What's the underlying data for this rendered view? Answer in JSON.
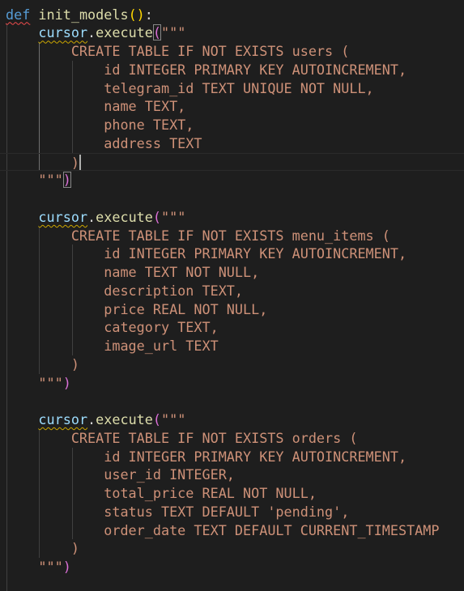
{
  "editor": {
    "language": "python",
    "lines": [
      {
        "indent": "",
        "tokens": [
          {
            "t": "def",
            "c": "kw squig"
          },
          {
            "t": " ",
            "c": "punc"
          },
          {
            "t": "init_models",
            "c": "fn"
          },
          {
            "t": "(",
            "c": "brk"
          },
          {
            "t": ")",
            "c": "brk"
          },
          {
            "t": ":",
            "c": "punc"
          }
        ]
      },
      {
        "indent": "    ",
        "tokens": [
          {
            "t": "cursor",
            "c": "var warn"
          },
          {
            "t": ".",
            "c": "punc"
          },
          {
            "t": "execute",
            "c": "fn"
          },
          {
            "t": "(",
            "c": "brk2 matchbox"
          },
          {
            "t": "\"\"\"",
            "c": "str"
          }
        ]
      },
      {
        "indent": "        ",
        "tokens": [
          {
            "t": "CREATE TABLE IF NOT EXISTS users (",
            "c": "str"
          }
        ]
      },
      {
        "indent": "            ",
        "tokens": [
          {
            "t": "id INTEGER PRIMARY KEY AUTOINCREMENT,",
            "c": "str"
          }
        ]
      },
      {
        "indent": "            ",
        "tokens": [
          {
            "t": "telegram_id TEXT UNIQUE NOT NULL,",
            "c": "str"
          }
        ]
      },
      {
        "indent": "            ",
        "tokens": [
          {
            "t": "name TEXT,",
            "c": "str"
          }
        ]
      },
      {
        "indent": "            ",
        "tokens": [
          {
            "t": "phone TEXT,",
            "c": "str"
          }
        ]
      },
      {
        "indent": "            ",
        "tokens": [
          {
            "t": "address TEXT",
            "c": "str"
          }
        ]
      },
      {
        "indent": "        ",
        "tokens": [
          {
            "t": ")",
            "c": "str"
          }
        ],
        "caret": true,
        "current": true
      },
      {
        "indent": "    ",
        "tokens": [
          {
            "t": "\"\"\"",
            "c": "str"
          },
          {
            "t": ")",
            "c": "brk2 matchbox"
          }
        ]
      },
      {
        "indent": "",
        "tokens": []
      },
      {
        "indent": "    ",
        "tokens": [
          {
            "t": "cursor",
            "c": "var warn"
          },
          {
            "t": ".",
            "c": "punc"
          },
          {
            "t": "execute",
            "c": "fn"
          },
          {
            "t": "(",
            "c": "brk2"
          },
          {
            "t": "\"\"\"",
            "c": "str"
          }
        ]
      },
      {
        "indent": "        ",
        "tokens": [
          {
            "t": "CREATE TABLE IF NOT EXISTS menu_items (",
            "c": "str"
          }
        ]
      },
      {
        "indent": "            ",
        "tokens": [
          {
            "t": "id INTEGER PRIMARY KEY AUTOINCREMENT,",
            "c": "str"
          }
        ]
      },
      {
        "indent": "            ",
        "tokens": [
          {
            "t": "name TEXT NOT NULL,",
            "c": "str"
          }
        ]
      },
      {
        "indent": "            ",
        "tokens": [
          {
            "t": "description TEXT,",
            "c": "str"
          }
        ]
      },
      {
        "indent": "            ",
        "tokens": [
          {
            "t": "price REAL NOT NULL,",
            "c": "str"
          }
        ]
      },
      {
        "indent": "            ",
        "tokens": [
          {
            "t": "category TEXT,",
            "c": "str"
          }
        ]
      },
      {
        "indent": "            ",
        "tokens": [
          {
            "t": "image_url TEXT",
            "c": "str"
          }
        ]
      },
      {
        "indent": "        ",
        "tokens": [
          {
            "t": ")",
            "c": "str"
          }
        ]
      },
      {
        "indent": "    ",
        "tokens": [
          {
            "t": "\"\"\"",
            "c": "str"
          },
          {
            "t": ")",
            "c": "brk2"
          }
        ]
      },
      {
        "indent": "",
        "tokens": []
      },
      {
        "indent": "    ",
        "tokens": [
          {
            "t": "cursor",
            "c": "var warn"
          },
          {
            "t": ".",
            "c": "punc"
          },
          {
            "t": "execute",
            "c": "fn"
          },
          {
            "t": "(",
            "c": "brk2"
          },
          {
            "t": "\"\"\"",
            "c": "str"
          }
        ]
      },
      {
        "indent": "        ",
        "tokens": [
          {
            "t": "CREATE TABLE IF NOT EXISTS orders (",
            "c": "str"
          }
        ]
      },
      {
        "indent": "            ",
        "tokens": [
          {
            "t": "id INTEGER PRIMARY KEY AUTOINCREMENT,",
            "c": "str"
          }
        ]
      },
      {
        "indent": "            ",
        "tokens": [
          {
            "t": "user_id INTEGER,",
            "c": "str"
          }
        ]
      },
      {
        "indent": "            ",
        "tokens": [
          {
            "t": "total_price REAL NOT NULL,",
            "c": "str"
          }
        ]
      },
      {
        "indent": "            ",
        "tokens": [
          {
            "t": "status TEXT DEFAULT 'pending',",
            "c": "str"
          }
        ]
      },
      {
        "indent": "            ",
        "tokens": [
          {
            "t": "order_date TEXT DEFAULT CURRENT_TIMESTAMP",
            "c": "str"
          }
        ]
      },
      {
        "indent": "        ",
        "tokens": [
          {
            "t": ")",
            "c": "str"
          }
        ]
      },
      {
        "indent": "    ",
        "tokens": [
          {
            "t": "\"\"\"",
            "c": "str"
          },
          {
            "t": ")",
            "c": "brk2"
          }
        ]
      },
      {
        "indent": "",
        "tokens": []
      }
    ]
  },
  "colors": {
    "background": "#1e1e1e",
    "keyword": "#569cd6",
    "function": "#dcdcaa",
    "variable": "#9cdcfe",
    "string": "#ce9178",
    "bracket_level1": "#ffd700",
    "bracket_level2": "#da70d6",
    "error_squiggle": "#f14c4c",
    "warning_squiggle": "#cca700"
  }
}
